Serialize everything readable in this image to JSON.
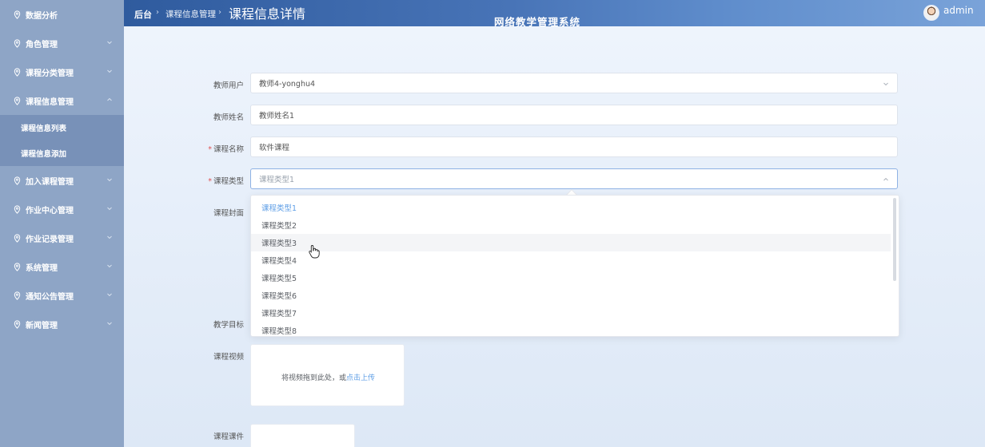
{
  "sidebar": {
    "items": [
      {
        "label": "数据分析"
      },
      {
        "label": "角色管理"
      },
      {
        "label": "课程分类管理"
      },
      {
        "label": "课程信息管理"
      },
      {
        "label": "加入课程管理"
      },
      {
        "label": "作业中心管理"
      },
      {
        "label": "作业记录管理"
      },
      {
        "label": "系统管理"
      },
      {
        "label": "通知公告管理"
      },
      {
        "label": "新闻管理"
      }
    ],
    "subitems": [
      {
        "label": "课程信息列表"
      },
      {
        "label": "课程信息添加"
      }
    ]
  },
  "header": {
    "breadcrumb_home": "后台",
    "breadcrumb_parent": "课程信息管理",
    "breadcrumb_current": "课程信息详情",
    "separator": "›",
    "system_title": "网络教学管理系统",
    "username": "admin"
  },
  "form": {
    "teacher_user": {
      "label": "教师用户",
      "value": "教师4-yonghu4"
    },
    "teacher_name": {
      "label": "教师姓名",
      "value": "教师姓名1"
    },
    "course_name": {
      "label": "课程名称",
      "value": "软件课程",
      "required_mark": "*"
    },
    "course_type": {
      "label": "课程类型",
      "placeholder": "课程类型1",
      "required_mark": "*"
    },
    "course_cover": {
      "label": "课程封面"
    },
    "teaching_goal": {
      "label": "教学目标"
    },
    "course_video": {
      "label": "课程视频",
      "drop_text": "将视频拖到此处，或",
      "upload_link": "点击上传"
    },
    "course_ware": {
      "label": "课程课件"
    }
  },
  "dropdown": {
    "options": [
      "课程类型1",
      "课程类型2",
      "课程类型3",
      "课程类型4",
      "课程类型5",
      "课程类型6",
      "课程类型7",
      "课程类型8"
    ],
    "selected_index": 0,
    "hovered_index": 2
  },
  "colors": {
    "sidebar_bg": "#8ea5c6",
    "submenu_bg": "#7891b8",
    "header_start": "#2f5b9e",
    "accent": "#5e9ee6",
    "required": "#e05252"
  }
}
